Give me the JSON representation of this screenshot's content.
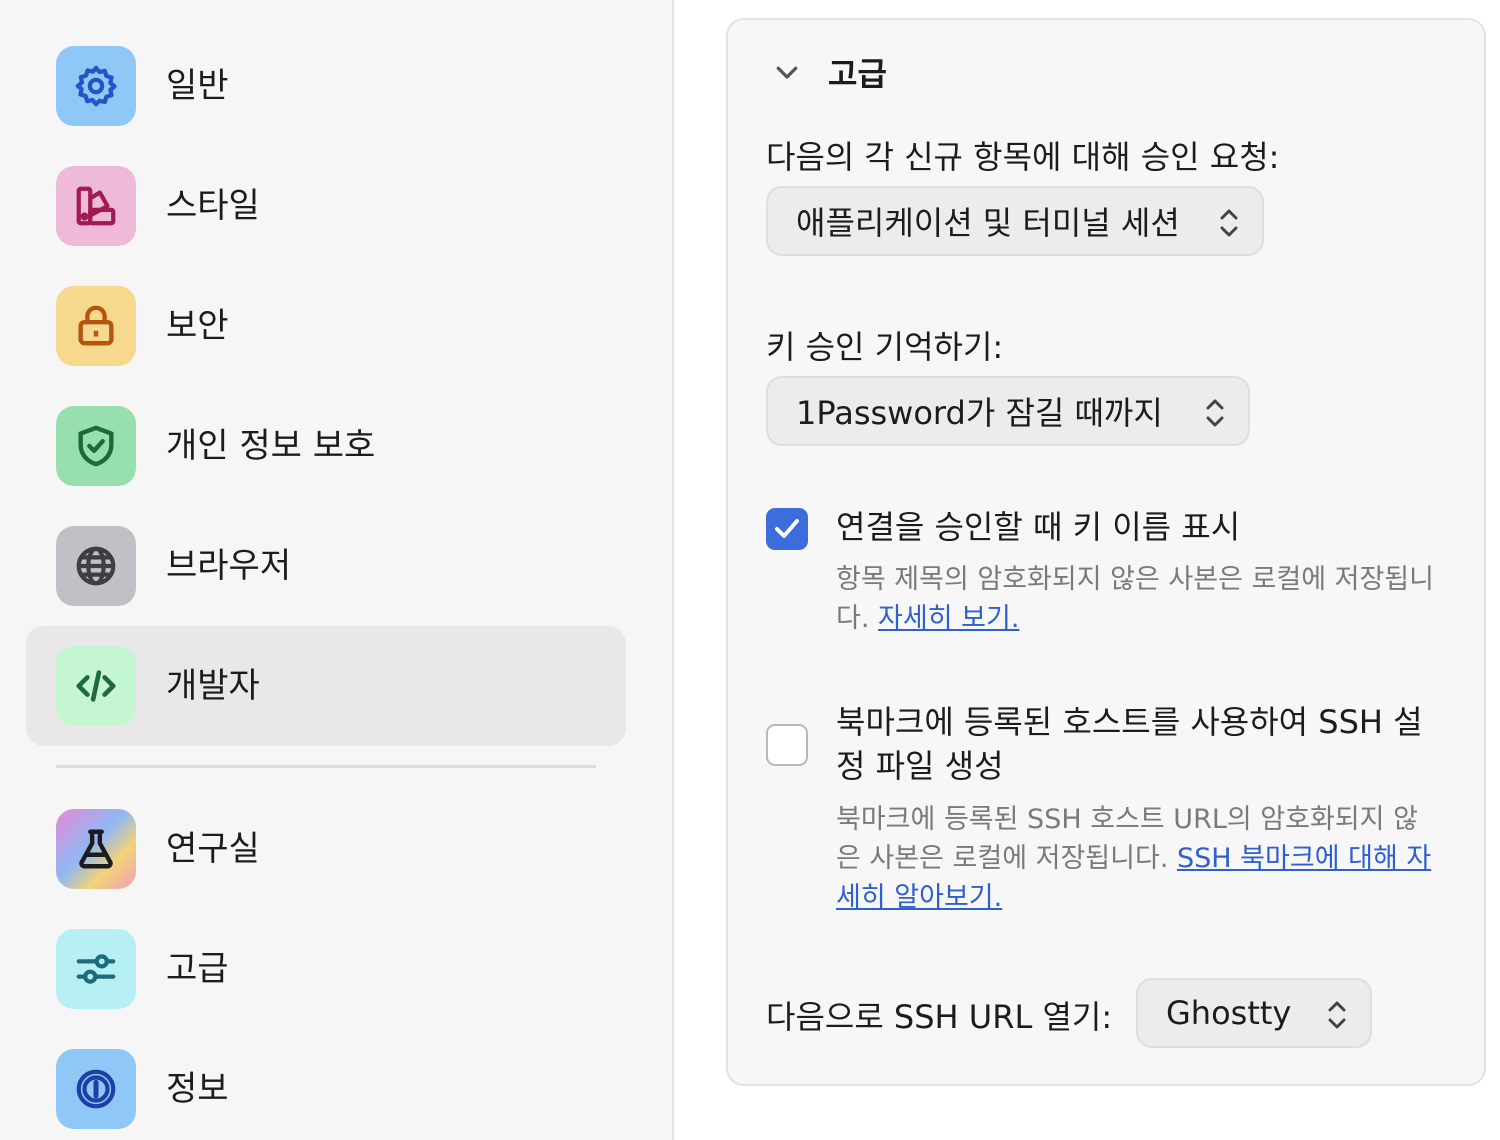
{
  "sidebar": {
    "items": [
      {
        "label": "일반",
        "icon": "gear-icon",
        "icon_bg": "#8fc8f6",
        "icon_color": "#1f57c8",
        "selected": false
      },
      {
        "label": "스타일",
        "icon": "palette-icon",
        "icon_bg": "#efb9d9",
        "icon_color": "#a11b4f",
        "selected": false
      },
      {
        "label": "보안",
        "icon": "lock-icon",
        "icon_bg": "#f6d98e",
        "icon_color": "#b6560e",
        "selected": false
      },
      {
        "label": "개인 정보 보호",
        "icon": "shield-check-icon",
        "icon_bg": "#97e0ad",
        "icon_color": "#1c6a3a",
        "selected": false
      },
      {
        "label": "브라우저",
        "icon": "globe-icon",
        "icon_bg": "#bfc1c6",
        "icon_color": "#3d3f45",
        "selected": false
      },
      {
        "label": "개발자",
        "icon": "code-icon",
        "icon_bg": "#c4f6d2",
        "icon_color": "#1e6a3a",
        "selected": true
      },
      {
        "label": "연구실",
        "icon": "flask-icon",
        "icon_bg": "gradient",
        "icon_color": "#1c1c1e",
        "selected": false
      },
      {
        "label": "고급",
        "icon": "sliders-icon",
        "icon_bg": "#b6f0f4",
        "icon_color": "#1d6c7a",
        "selected": false
      },
      {
        "label": "정보",
        "icon": "1password-logo-icon",
        "icon_bg": "#8fc8f6",
        "icon_color": "#1f3fa8",
        "selected": false
      }
    ]
  },
  "advanced": {
    "section_title": "고급",
    "approval_label": "다음의 각 신규 항목에 대해 승인 요청:",
    "approval_value": "애플리케이션 및 터미널 세션",
    "remember_label": "키 승인 기억하기:",
    "remember_value": "1Password가 잠길 때까지",
    "show_key_names": {
      "checked": true,
      "title": "연결을 승인할 때 키 이름 표시",
      "desc": "항목 제목의 암호화되지 않은 사본은 로컬에 저장됩니다.",
      "link": "자세히 보기."
    },
    "ssh_config": {
      "checked": false,
      "title": "북마크에 등록된 호스트를 사용하여 SSH 설정 파일 생성",
      "desc": "북마크에 등록된 SSH 호스트 URL의 암호화되지 않은 사본은 로컬에 저장됩니다.",
      "link": "SSH 북마크에 대해 자세히 알아보기."
    },
    "open_ssh_label": "다음으로 SSH URL 열기:",
    "open_ssh_value": "Ghostty"
  },
  "colors": {
    "accent": "#3d6cdc",
    "link": "#2f5fd0"
  }
}
